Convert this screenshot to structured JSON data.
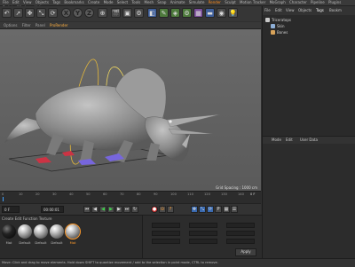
{
  "app": {
    "menu": [
      "File",
      "Edit",
      "View",
      "Objects",
      "Tags",
      "Bookmarks",
      "Create",
      "Mode",
      "Select",
      "Tools",
      "Mesh",
      "Snap",
      "Animate",
      "Simulate",
      "Render",
      "Sculpt",
      "Motion Tracker",
      "MoGraph",
      "Character",
      "Pipeline",
      "Plugins",
      "Script",
      "Window",
      "Help"
    ],
    "accent_color": "#ff8c1a"
  },
  "toolbar": {
    "x_label": "X",
    "y_label": "Y",
    "z_label": "Z"
  },
  "viewport": {
    "menu": [
      "Options",
      "Filter",
      "Panel",
      "ProRender"
    ],
    "grid_spacing": "Grid Spacing : 1000 cm"
  },
  "timeline": {
    "ticks": [
      "0",
      "10",
      "20",
      "30",
      "40",
      "50",
      "60",
      "70",
      "80",
      "90",
      "100",
      "110",
      "120",
      "130",
      "140"
    ],
    "current_frame": "0 F"
  },
  "transport": {
    "start_field": "0 F",
    "current_field": "00:00:01",
    "end_field": "90 F",
    "max_field": "90 F"
  },
  "materials": {
    "header": "Create  Edit  Function  Texture",
    "items": [
      {
        "label": "Mat",
        "style": "black"
      },
      {
        "label": "Default",
        "style": "white"
      },
      {
        "label": "Default",
        "style": "white"
      },
      {
        "label": "Default",
        "style": "white"
      },
      {
        "label": "Mat",
        "style": "white",
        "selected": true
      }
    ]
  },
  "coordinates": {
    "apply_label": "Apply"
  },
  "status": {
    "text": "Move: Click and drag to move elements. Hold down SHIFT to quantize movement / add to the selection in point mode, CTRL to remove."
  },
  "objects_panel": {
    "tabs": [
      "File",
      "Edit",
      "View",
      "Objects",
      "Tags",
      "Bookm"
    ],
    "items": [
      {
        "label": "Triceratops",
        "color": "#c8c8c8"
      },
      {
        "label": "Skin",
        "color": "#8fb0d8"
      },
      {
        "label": "Bones",
        "color": "#d8a35a"
      }
    ]
  },
  "attributes_panel": {
    "tabs": [
      "Mode",
      "Edit",
      "User Data"
    ]
  }
}
